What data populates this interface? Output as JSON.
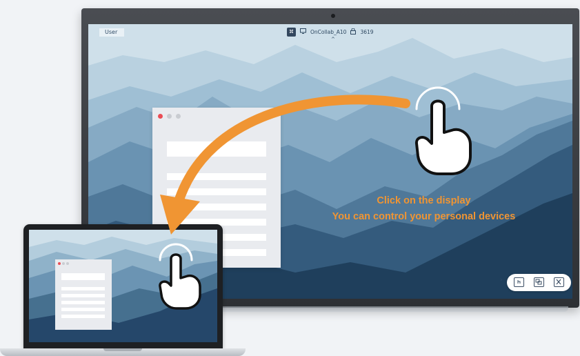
{
  "display": {
    "user_label": "User",
    "cast_badge": "⌘",
    "device_name": "OnCollab_A10",
    "pin_code": "3619",
    "chevron": "^",
    "toolbar": {
      "expand_glyph": "›",
      "buttons": [
        "touch-control-button",
        "screen-mirror-button",
        "close-cast-button"
      ]
    }
  },
  "caption": {
    "line1": "Click on the display",
    "line2": "You can control your personal devices"
  },
  "colors": {
    "accent": "#f09533",
    "mountain_light": "#c7dbe6",
    "mountain_dark": "#1d3a55",
    "window_dot_red": "#ea4d55",
    "window_dot_grey": "#c9ccd1"
  }
}
